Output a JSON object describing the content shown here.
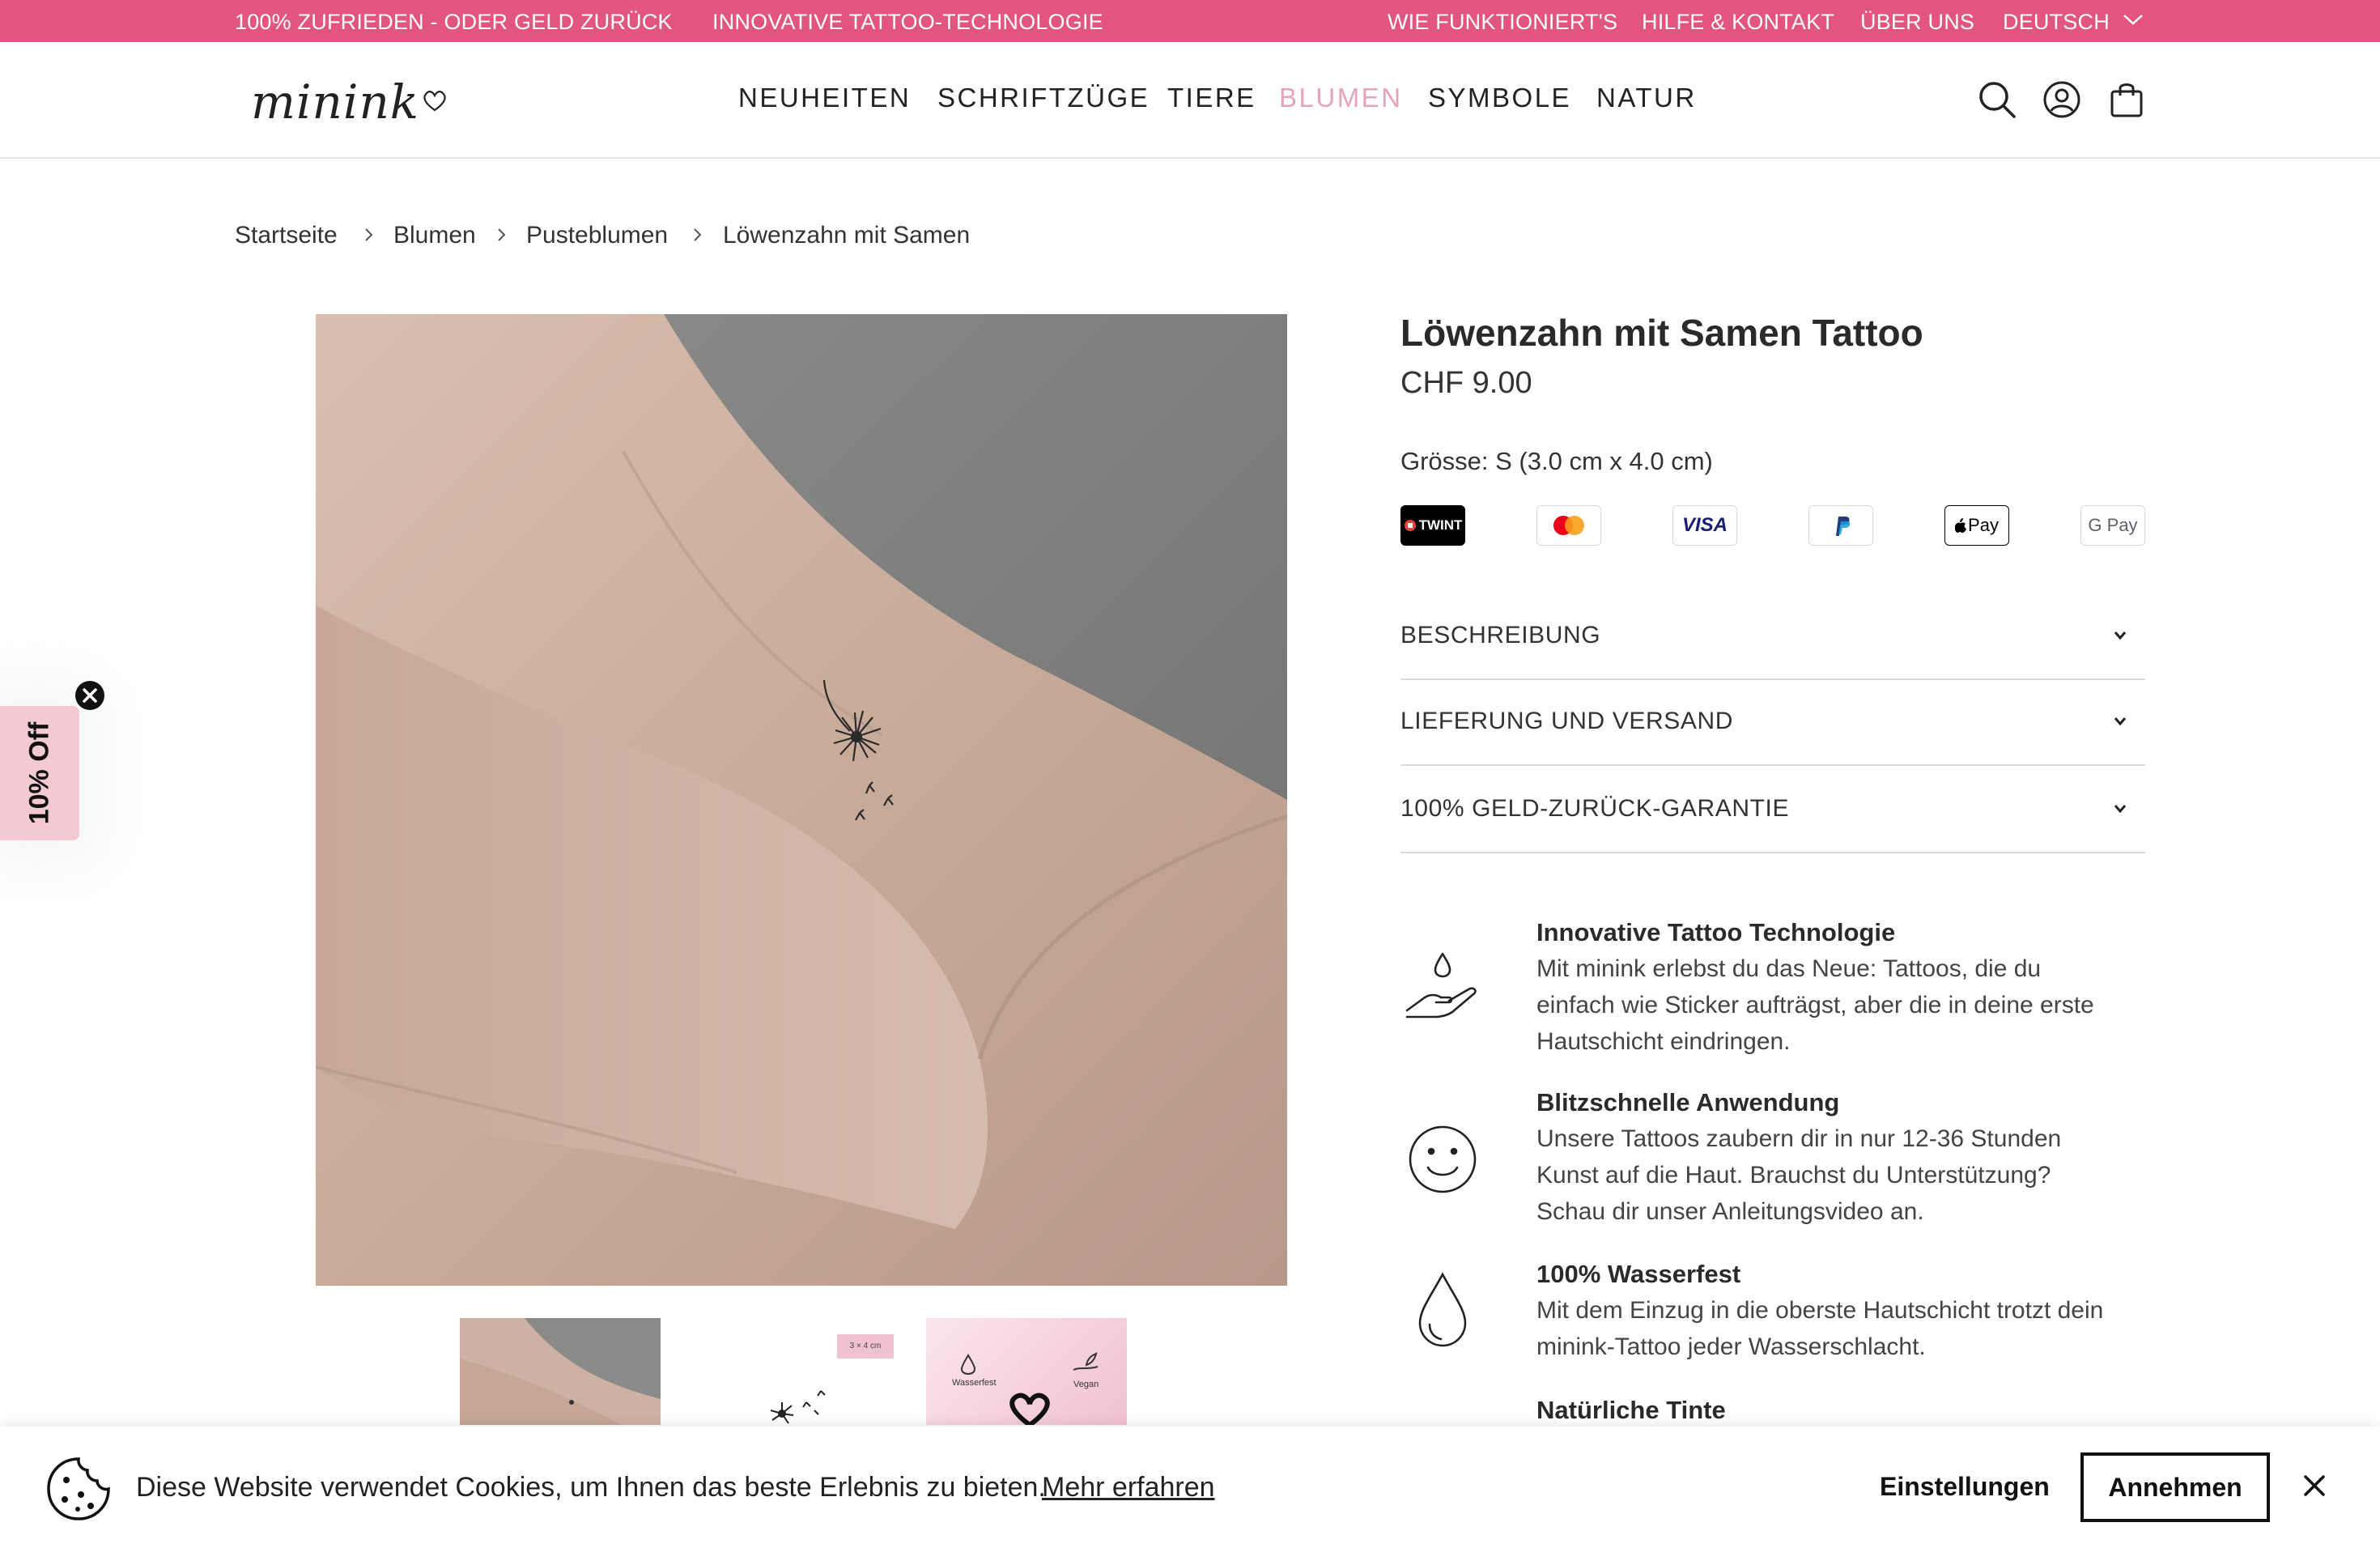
{
  "topbar": {
    "promo_left": "100% ZUFRIEDEN - ODER GELD ZURÜCK",
    "promo_right": "INNOVATIVE TATTOO-TECHNOLOGIE",
    "links": [
      "WIE FUNKTIONIERT'S",
      "HILFE & KONTAKT",
      "ÜBER UNS"
    ],
    "language": "DEUTSCH",
    "background": "#e25580"
  },
  "header": {
    "logo": "minink",
    "nav": [
      "NEUHEITEN",
      "SCHRIFTZÜGE",
      "TIERE",
      "BLUMEN",
      "SYMBOLE",
      "NATUR"
    ],
    "active_nav": "BLUMEN",
    "active_color": "#e8a4b7",
    "icons": [
      "search-icon",
      "account-icon",
      "cart-icon"
    ]
  },
  "breadcrumb": [
    "Startseite",
    "Blumen",
    "Pusteblumen",
    "Löwenzahn mit Samen"
  ],
  "gallery": {
    "thumb_size_label": "3 × 4 cm",
    "thumb_labels": [
      "Wasserfest",
      "Vegan"
    ]
  },
  "product": {
    "title": "Löwenzahn mit Samen Tattoo",
    "price": "CHF 9.00",
    "size": "Grösse: S (3.0 cm x 4.0 cm)",
    "payments": [
      "TWINT",
      "Mastercard",
      "VISA",
      "PayPal",
      "Apple Pay",
      "G Pay"
    ]
  },
  "accordion": [
    "BESCHREIBUNG",
    "LIEFERUNG UND VERSAND",
    "100% GELD-ZURÜCK-GARANTIE"
  ],
  "features": [
    {
      "title": "Innovative Tattoo Technologie",
      "lines": [
        "Mit minink erlebst du das Neue: Tattoos, die du",
        "einfach wie Sticker aufträgst, aber die in deine erste",
        "Hautschicht eindringen."
      ],
      "icon": "hand-drop-icon"
    },
    {
      "title": "Blitzschnelle Anwendung",
      "lines": [
        "Unsere Tattoos zaubern dir in nur 12-36 Stunden",
        "Kunst auf die Haut. Brauchst du Unterstützung?",
        "Schau dir unser Anleitungsvideo an."
      ],
      "icon": "smiley-icon"
    },
    {
      "title": "100% Wasserfest",
      "lines": [
        "Mit dem Einzug in die oberste Hautschicht trotzt dein",
        "minink-Tattoo jeder Wasserschlacht."
      ],
      "icon": "water-drop-icon"
    },
    {
      "title": "Natürliche Tinte",
      "lines": [],
      "icon": ""
    }
  ],
  "sidetab": {
    "label": "10% Off",
    "background": "#f3c9d3"
  },
  "cookie": {
    "text": "Diese Website verwendet Cookies, um Ihnen das beste Erlebnis zu bieten.",
    "link": "Mehr erfahren",
    "settings": "Einstellungen",
    "accept": "Annehmen"
  }
}
